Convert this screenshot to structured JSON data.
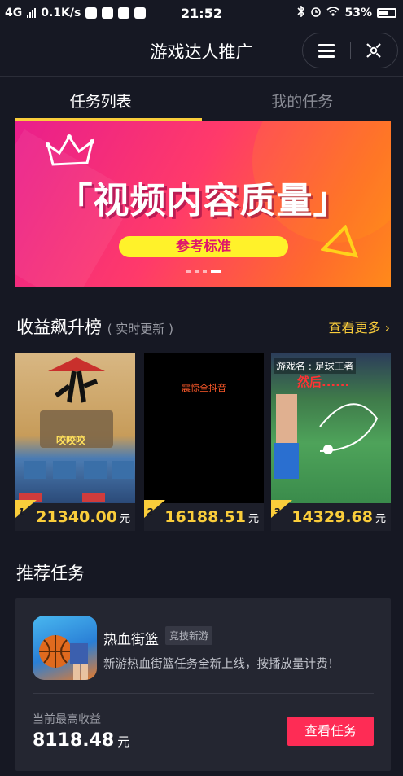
{
  "status_bar": {
    "network": "4G",
    "speed": "0.1K/s",
    "time": "21:52",
    "battery": "53%"
  },
  "header": {
    "title": "游戏达人推广",
    "menu_icon": "menu-icon",
    "close_icon": "target-close-icon"
  },
  "tabs": [
    {
      "label": "任务列表",
      "active": true
    },
    {
      "label": "我的任务",
      "active": false
    }
  ],
  "banner": {
    "headline": "「视频内容质量」",
    "cta": "参考标准",
    "page_count": 4,
    "active_page": 4
  },
  "ranking": {
    "title": "收益飙升榜",
    "subtitle": "( 实时更新 )",
    "more_label": "查看更多",
    "items": [
      {
        "rank": "1",
        "amount": "21340.00",
        "unit": "元",
        "thumb_text": "咬咬咬"
      },
      {
        "rank": "2",
        "amount": "16188.51",
        "unit": "元",
        "thumb_text": "震惊全抖音"
      },
      {
        "rank": "3",
        "amount": "14329.68",
        "unit": "元",
        "thumb_text": "游戏名 : 足球王者",
        "thumb_text2": "然后......"
      }
    ]
  },
  "recommended": {
    "title": "推荐任务",
    "task": {
      "name": "热血街篮",
      "tag": "竞技新游",
      "description": "新游热血街篮任务全新上线，按播放量计费！",
      "earn_label": "当前最高收益",
      "earn_value": "8118.48",
      "earn_unit": "元",
      "button_label": "查看任务"
    }
  },
  "colors": {
    "background": "#161823",
    "accent_yellow": "#facd3b",
    "button_red": "#fe2c55",
    "card": "#242631"
  }
}
